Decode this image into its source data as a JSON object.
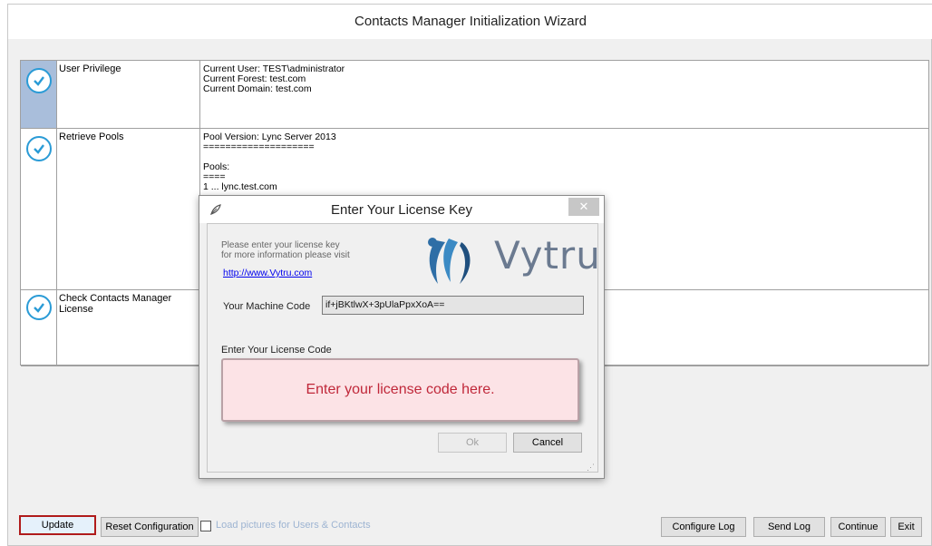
{
  "window": {
    "title": "Contacts Manager Initialization Wizard"
  },
  "steps": [
    {
      "name": "User Privilege",
      "detail": "Current User: TEST\\administrator\nCurrent Forest: test.com\nCurrent Domain: test.com",
      "status": "check-icon",
      "selected": true
    },
    {
      "name": "Retrieve Pools",
      "detail": "Pool Version: Lync Server 2013\n====================\n\nPools:\n====\n1 ... lync.test.com",
      "status": "check-icon",
      "selected": false
    },
    {
      "name": "Check Contacts Manager\nLicense",
      "detail": "",
      "status": "check-icon",
      "selected": false
    }
  ],
  "bottom": {
    "update": "Update",
    "reset": "Reset Configuration",
    "load_pictures": "Load pictures for Users & Contacts",
    "configure_log": "Configure Log",
    "send_log": "Send Log",
    "continue": "Continue",
    "exit": "Exit"
  },
  "dialog": {
    "title": "Enter Your License Key",
    "close": "✕",
    "info_line1": "Please enter your license key",
    "info_line2": "for more information please visit",
    "link": "http://www.Vytru.com",
    "logo_text": "Vytru",
    "machine_code_label": "Your Machine Code",
    "machine_code_value": "if+jBKtlwX+3pUlaPpxXoA==",
    "license_code_label": "Enter Your License Code",
    "license_placeholder": "Enter your license code here.",
    "ok": "Ok",
    "cancel": "Cancel"
  },
  "colors": {
    "accent_check": "#2a9bd6",
    "selected_row": "#a9bedb",
    "highlight_border": "#b01b1b",
    "license_bg": "#fce3e6",
    "license_text": "#c0283a"
  }
}
